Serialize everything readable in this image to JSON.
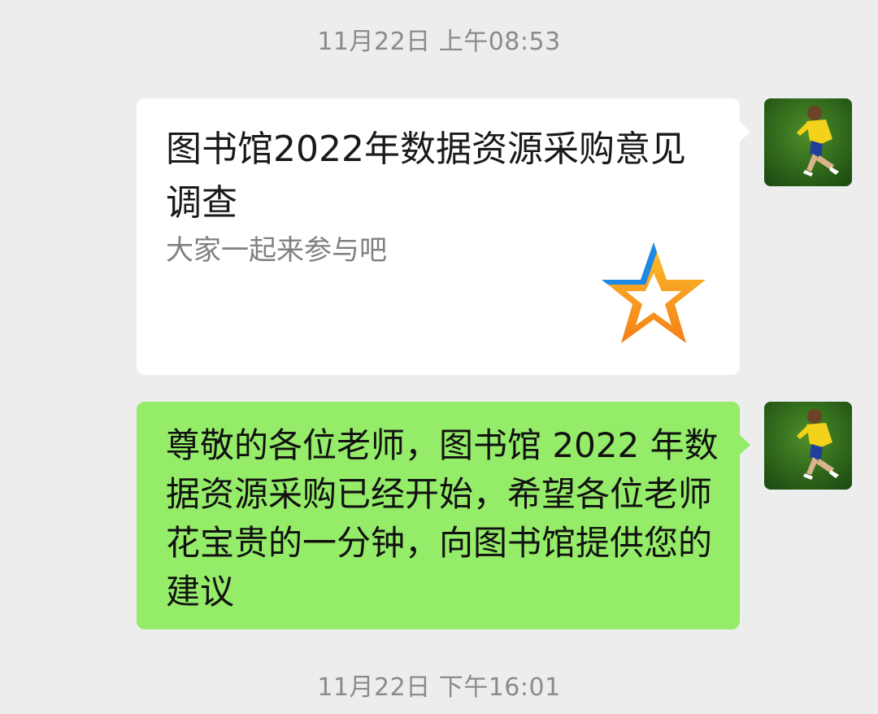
{
  "chat": {
    "timestamp_1": "11月22日 上午08:53",
    "timestamp_2": "11月22日 下午16:01",
    "messages": [
      {
        "type": "link_card",
        "title": "图书馆2022年数据资源采购意见调查",
        "description": "大家一起来参与吧",
        "thumbnail_icon": "star-icon"
      },
      {
        "type": "text",
        "text": "尊敬的各位老师，图书馆 2022 年数据资源采购已经开始，希望各位老师花宝贵的一分钟，向图书馆提供您的建议"
      }
    ],
    "sender_avatar_icon": "soccer-player-avatar"
  },
  "colors": {
    "background": "#ededed",
    "card_bg": "#ffffff",
    "bubble_green": "#95ec69",
    "timestamp_text": "#8b8b8b",
    "star_blue": "#1e88e5",
    "star_orange": "#f7a21b"
  }
}
